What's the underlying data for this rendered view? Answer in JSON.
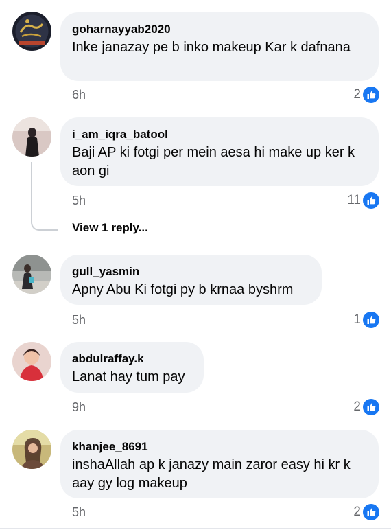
{
  "comments": [
    {
      "username": "goharnayyab2020",
      "text": "Inke janazay pe b inko makeup Kar k dafnana",
      "time": "6h",
      "likes": "2",
      "avatar_icon": "flag-logo-avatar"
    },
    {
      "username": "i_am_iqra_batool",
      "text": "Baji AP ki fotgi per mein aesa hi make up ker k aon gi",
      "time": "5h",
      "likes": "11",
      "avatar_icon": "person-photo-avatar"
    },
    {
      "username": "gull_yasmin",
      "text": "Apny Abu Ki fotgi py b krnaa byshrm",
      "time": "5h",
      "likes": "1",
      "avatar_icon": "person-photo-avatar"
    },
    {
      "username": "abdulraffay.k",
      "text": "Lanat hay tum pay",
      "time": "9h",
      "likes": "2",
      "avatar_icon": "person-photo-avatar"
    },
    {
      "username": "khanjee_8691",
      "text": "inshaAllah ap k janazy main zaror easy hi kr k aay gy log makeup",
      "time": "5h",
      "likes": "2",
      "avatar_icon": "person-photo-avatar"
    }
  ],
  "replies_link": "View 1 reply...",
  "colors": {
    "like_blue": "#1877f2",
    "bubble": "#f0f2f5",
    "meta_text": "#65676b"
  }
}
